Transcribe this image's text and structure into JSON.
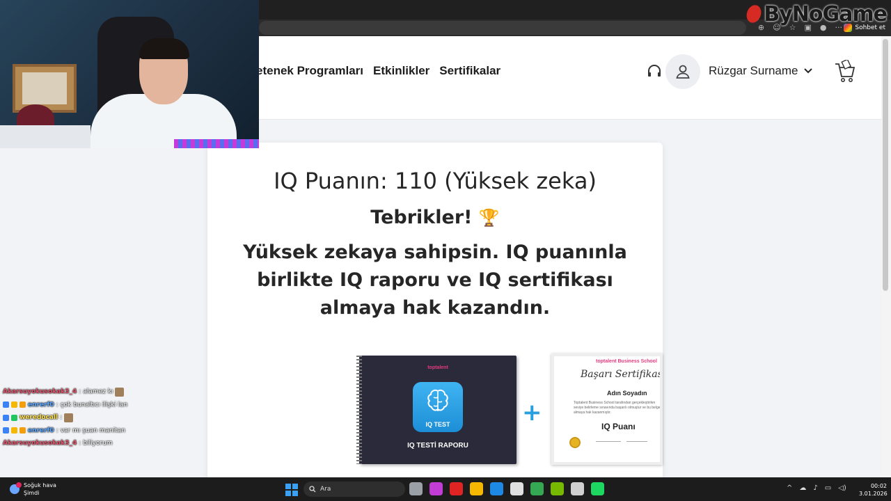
{
  "browser": {
    "chat_button_label": "Sohbet et",
    "watermark": "ByNoGame"
  },
  "header": {
    "nav": [
      "etenek Programları",
      "Etkinlikler",
      "Sertifikalar"
    ],
    "username": "Rüzgar Surname",
    "icons": {
      "bell": "headset-icon",
      "avatar": "user-icon",
      "cart": "cart-icon",
      "dropdown": "chevron-down-icon"
    }
  },
  "result": {
    "score_line": "IQ Puanın: 110 (Yüksek zeka)",
    "score": 110,
    "congrats": "Tebrikler!",
    "trophy": "🏆",
    "message": "Yüksek zekaya sahipsin. IQ puanınla birlikte IQ raporu ve IQ sertifikası almaya hak kazandın."
  },
  "products": {
    "report": {
      "brand": "toptalent",
      "tile_label": "IQ TEST",
      "caption": "IQ TESTİ RAPORU"
    },
    "plus": "+",
    "certificate": {
      "brand": "toptalent Business School",
      "title": "Başarı Sertifikası",
      "name": "Adın Soyadın",
      "description": "Toptalent Business School tarafından gerçekleştirilen seviye belirleme sınavında başarılı olmuştur ve bu belgeyi almaya hak kazanmıştır.",
      "iq_label": "IQ Puanı"
    }
  },
  "chat": [
    {
      "user": "Akarsuyokusokak3_4",
      "user_color": "#e0526b",
      "message": "alamez kı",
      "badges": [],
      "emote": true
    },
    {
      "user": "enrerf0",
      "user_color": "#5aa6ff",
      "message": "çok bunaltıcı ilişki lan",
      "badges": [
        "#3b82f6",
        "#f5b700",
        "#f59e0b"
      ],
      "emote": false
    },
    {
      "user": "weredocall",
      "user_color": "#ffe14d",
      "message": "",
      "badges": [
        "#3b82f6",
        "#22c55e"
      ],
      "emote": true
    },
    {
      "user": "enrerf0",
      "user_color": "#5aa6ff",
      "message": "var mı şuan manitan",
      "badges": [
        "#3b82f6",
        "#f5b700",
        "#f59e0b"
      ],
      "emote": false
    },
    {
      "user": "Akarsuyokusokak3_4",
      "user_color": "#e0526b",
      "message": "biliyorum",
      "badges": [],
      "emote": false
    }
  ],
  "taskbar": {
    "weather_title": "Soğuk hava",
    "weather_sub": "Şimdi",
    "search_placeholder": "Ara",
    "time": "00:02",
    "date": "3.01.2026",
    "app_colors": [
      "#9aa0a6",
      "#c23cd6",
      "#e02424",
      "#f5b700",
      "#1e88e5",
      "#e0e0e0",
      "#34a853",
      "#76b900",
      "#d0d0d0",
      "#1ed760"
    ]
  }
}
